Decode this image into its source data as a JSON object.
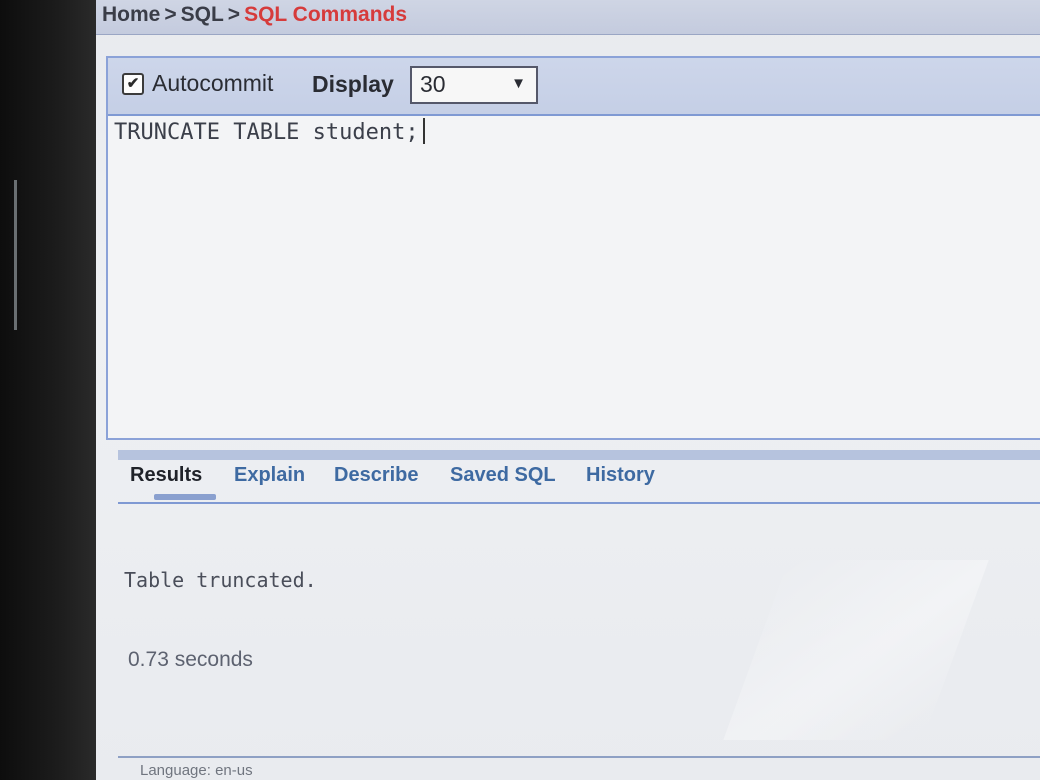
{
  "breadcrumb": {
    "items": [
      "Home",
      "SQL",
      "SQL Commands"
    ],
    "separator": ">",
    "current_color": "#d63b3b"
  },
  "toolbar": {
    "autocommit_label": "Autocommit",
    "autocommit_checked": true,
    "checkbox_glyph": "✔",
    "display_label": "Display",
    "display_value": "30",
    "dropdown_arrow": "▼"
  },
  "editor": {
    "sql_text": "TRUNCATE TABLE student;"
  },
  "tabs": [
    {
      "label": "Results",
      "active": true
    },
    {
      "label": "Explain",
      "active": false
    },
    {
      "label": "Describe",
      "active": false
    },
    {
      "label": "Saved SQL",
      "active": false
    },
    {
      "label": "History",
      "active": false
    }
  ],
  "results": {
    "message": "Table truncated.",
    "elapsed": "0.73 seconds"
  },
  "footer": {
    "language": "Language: en-us"
  },
  "colors": {
    "accent_blue": "#7f99d3",
    "link_blue": "#3e6aa2"
  }
}
